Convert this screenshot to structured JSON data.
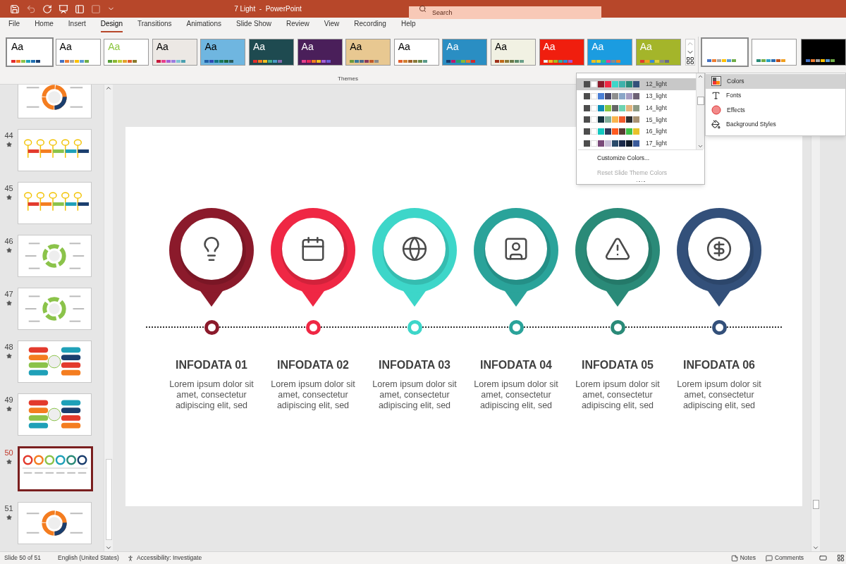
{
  "window": {
    "title": "7 Light  -  PowerPoint"
  },
  "search": {
    "placeholder": "Search"
  },
  "tabs": [
    {
      "label": "File",
      "selected": false
    },
    {
      "label": "Home",
      "selected": false
    },
    {
      "label": "Insert",
      "selected": false
    },
    {
      "label": "Design",
      "selected": true
    },
    {
      "label": "Transitions",
      "selected": false
    },
    {
      "label": "Animations",
      "selected": false
    },
    {
      "label": "Slide Show",
      "selected": false
    },
    {
      "label": "Review",
      "selected": false
    },
    {
      "label": "View",
      "selected": false
    },
    {
      "label": "Recording",
      "selected": false
    },
    {
      "label": "Help",
      "selected": false
    }
  ],
  "themes_group": {
    "label": "Themes",
    "themes": [
      {
        "label": "Aa",
        "selected": true
      },
      {
        "label": "Aa",
        "selected": false
      },
      {
        "label": "Aa",
        "selected": false
      },
      {
        "label": "Aa",
        "selected": false
      },
      {
        "label": "Aa",
        "selected": false
      },
      {
        "label": "Aa",
        "selected": false
      },
      {
        "label": "Aa",
        "selected": false
      },
      {
        "label": "Aa",
        "selected": false
      },
      {
        "label": "Aa",
        "selected": false
      },
      {
        "label": "Aa",
        "selected": false
      },
      {
        "label": "Aa",
        "selected": false
      },
      {
        "label": "Aa",
        "selected": false
      },
      {
        "label": "Aa",
        "selected": false
      },
      {
        "label": "Aa",
        "selected": false
      }
    ]
  },
  "variants": [
    {
      "selected": true
    },
    {
      "selected": false
    },
    {
      "selected": false
    }
  ],
  "slide_thumbnails": [
    {
      "kind": "ring",
      "selected": false
    },
    {
      "number": "44",
      "kind": "keys",
      "selected": false
    },
    {
      "number": "45",
      "kind": "keys",
      "selected": false
    },
    {
      "number": "46",
      "kind": "cycle",
      "selected": false
    },
    {
      "number": "47",
      "kind": "cycle",
      "selected": false
    },
    {
      "number": "48",
      "kind": "pills",
      "selected": false
    },
    {
      "number": "49",
      "kind": "pills",
      "selected": false
    },
    {
      "number": "50",
      "kind": "pins",
      "selected": true
    },
    {
      "number": "51",
      "kind": "ring",
      "selected": false
    }
  ],
  "slide": {
    "items": [
      {
        "title": "INFODATA 01",
        "body": "Lorem ipsum dolor sit amet, consectetur adipiscing elit, sed",
        "color": "#8b1a2b",
        "kind": "bulb"
      },
      {
        "title": "INFODATA 02",
        "body": "Lorem ipsum dolor sit amet, consectetur adipiscing elit, sed",
        "color": "#ef2744",
        "kind": "calendar"
      },
      {
        "title": "INFODATA 03",
        "body": "Lorem ipsum dolor sit amet, consectetur adipiscing elit, sed",
        "color": "#3dd6c9",
        "kind": "globe"
      },
      {
        "title": "INFODATA 04",
        "body": "Lorem ipsum dolor sit amet, consectetur adipiscing elit, sed",
        "color": "#2aa39a",
        "kind": "person"
      },
      {
        "title": "INFODATA 05",
        "body": "Lorem ipsum dolor sit amet, consectetur adipiscing elit, sed",
        "color": "#2a8a78",
        "kind": "warning"
      },
      {
        "title": "INFODATA 06",
        "body": "Lorem ipsum dolor sit amet, consectetur adipiscing elit, sed",
        "color": "#33507a",
        "kind": "dollar"
      }
    ]
  },
  "colors_menu": {
    "schemes": [
      {
        "name": "12_light",
        "selected": true
      },
      {
        "name": "13_light",
        "selected": false
      },
      {
        "name": "14_light",
        "selected": false
      },
      {
        "name": "15_light",
        "selected": false
      },
      {
        "name": "16_light",
        "selected": false
      },
      {
        "name": "17_light",
        "selected": false
      }
    ],
    "actions": [
      {
        "label": "Customize Colors...",
        "disabled": false
      },
      {
        "label": "Reset Slide Theme Colors",
        "disabled": true
      }
    ]
  },
  "variants_menu": [
    {
      "label": "Colors",
      "kind": "colors",
      "selected": true
    },
    {
      "label": "Fonts",
      "kind": "fonts",
      "selected": false
    },
    {
      "label": "Effects",
      "kind": "effects",
      "selected": false
    },
    {
      "label": "Background Styles",
      "kind": "background",
      "selected": false
    }
  ],
  "status_bar": {
    "slide": "Slide 50 of 51",
    "language": "English (United States)",
    "accessibility": "Accessibility: Investigate",
    "notes": "Notes",
    "comments": "Comments"
  }
}
